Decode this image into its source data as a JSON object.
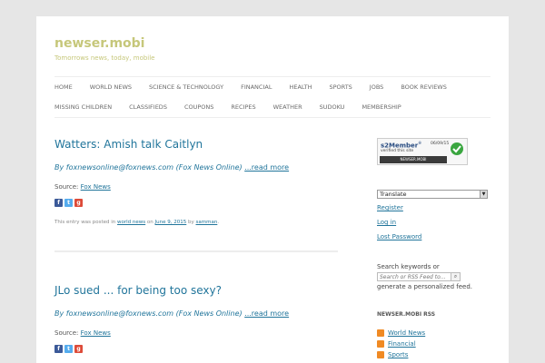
{
  "site": {
    "title": "newser.mobi",
    "tagline": "Tomorrows news, today, mobile"
  },
  "nav": {
    "row1": [
      "HOME",
      "WORLD NEWS",
      "SCIENCE & TECHNOLOGY",
      "FINANCIAL",
      "HEALTH",
      "SPORTS",
      "JOBS",
      "BOOK REVIEWS"
    ],
    "row2": [
      "MISSING CHILDREN",
      "CLASSIFIEDS",
      "COUPONS",
      "RECIPES",
      "WEATHER",
      "SUDOKU",
      "MEMBERSHIP"
    ]
  },
  "posts": [
    {
      "title": "Watters: Amish talk Caitlyn",
      "byline": "By foxnewsonline@foxnews.com (Fox News Online)",
      "more": "...read more",
      "source_label": "Source:",
      "source": "Fox News",
      "meta_prefix": "This entry was posted in",
      "category": "world news",
      "meta_on": "on",
      "date": "June 9, 2015",
      "meta_by": "by",
      "author": "samman",
      "meta_end": "."
    },
    {
      "title": "JLo sued ... for being too sexy?",
      "byline": "By foxnewsonline@foxnews.com (Fox News Online)",
      "more": "...read more",
      "source_label": "Source:",
      "source": "Fox News"
    }
  ],
  "share_icons": [
    "facebook-icon",
    "twitter-icon",
    "google-plus-icon"
  ],
  "sidebar": {
    "badge": {
      "brand": "s2Member",
      "mark": "®",
      "date": "06/09/15",
      "note": "verified this site",
      "strip": "NEWSER.MOBI"
    },
    "translate": "Translate",
    "links": [
      "Register",
      "Log in",
      "Lost Password"
    ],
    "search_label": "Search keywords or",
    "search_placeholder": "Search or RSS Feed to...",
    "search_after": "generate a personalized feed.",
    "rss_heading": "NEWSER.MOBI RSS",
    "rss_items": [
      "World News",
      "Financial",
      "Sports"
    ]
  },
  "colors": {
    "accent": "#21759b",
    "title": "#c6c77a",
    "rss": "#f08a24"
  }
}
